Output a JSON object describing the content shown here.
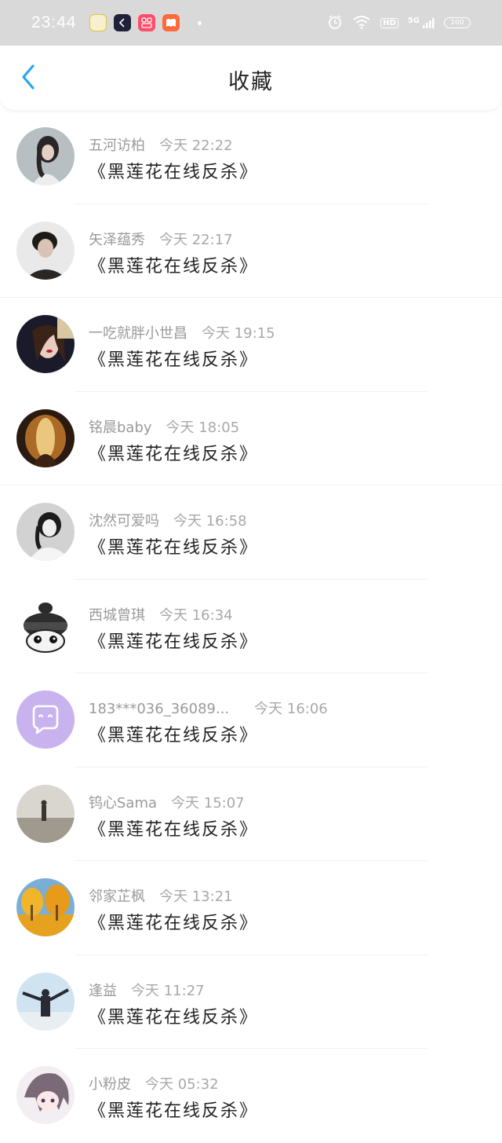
{
  "status_bar": {
    "time": "23:44",
    "network": "5G",
    "hd": "HD",
    "battery": "100"
  },
  "header": {
    "title": "收藏"
  },
  "favorites": [
    {
      "user": "五河访柏",
      "time": "今天 22:22",
      "book": "《黑莲花在线反杀》"
    },
    {
      "user": "矢泽蕴秀",
      "time": "今天 22:17",
      "book": "《黑莲花在线反杀》"
    },
    {
      "user": "一吃就胖小世昌",
      "time": "今天 19:15",
      "book": "《黑莲花在线反杀》"
    },
    {
      "user": "铭晨baby",
      "time": "今天 18:05",
      "book": "《黑莲花在线反杀》"
    },
    {
      "user": "沈然可爱吗",
      "time": "今天 16:58",
      "book": "《黑莲花在线反杀》"
    },
    {
      "user": "西城曾琪",
      "time": "今天 16:34",
      "book": "《黑莲花在线反杀》"
    },
    {
      "user": "183***036_36089...",
      "time": "今天 16:06",
      "book": "《黑莲花在线反杀》"
    },
    {
      "user": "钨心Sama",
      "time": "今天 15:07",
      "book": "《黑莲花在线反杀》"
    },
    {
      "user": "邻家芷枫",
      "time": "今天 13:21",
      "book": "《黑莲花在线反杀》"
    },
    {
      "user": "逢益",
      "time": "今天 11:27",
      "book": "《黑莲花在线反杀》"
    },
    {
      "user": "小粉皮",
      "time": "今天 05:32",
      "book": "《黑莲花在线反杀》"
    }
  ],
  "colors": {
    "accent": "#2ba6e8",
    "status_bar_bg": "#d9d9d9",
    "meta_text": "#9a9a9a",
    "title_text": "#222222",
    "default_avatar_bg": "#c9b3ee"
  }
}
